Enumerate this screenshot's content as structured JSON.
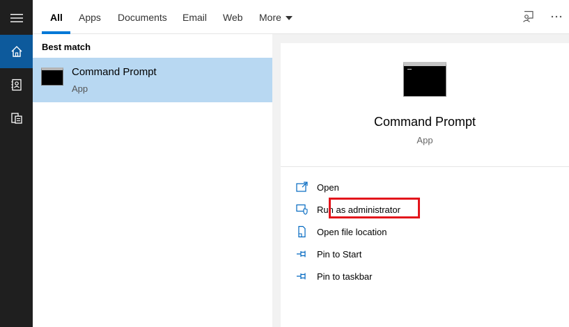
{
  "tabs": [
    {
      "label": "All",
      "active": true
    },
    {
      "label": "Apps"
    },
    {
      "label": "Documents"
    },
    {
      "label": "Email"
    },
    {
      "label": "Web"
    },
    {
      "label": "More"
    }
  ],
  "results": {
    "section_label": "Best match",
    "best_match": {
      "title": "Command Prompt",
      "subtitle": "App"
    }
  },
  "details": {
    "title": "Command Prompt",
    "subtitle": "App",
    "actions": [
      {
        "label": "Open",
        "icon": "open-icon"
      },
      {
        "label": "Run as administrator",
        "icon": "shield-icon",
        "highlighted": true
      },
      {
        "label": "Open file location",
        "icon": "file-location-icon"
      },
      {
        "label": "Pin to Start",
        "icon": "pin-icon"
      },
      {
        "label": "Pin to taskbar",
        "icon": "pin-icon"
      }
    ]
  },
  "colors": {
    "accent": "#0078d7",
    "rail_bg": "#1f1f1f",
    "rail_active": "#0d5a9c",
    "selected_result": "#b8d8f2",
    "highlight": "#e3141b"
  },
  "icons": {
    "rail": [
      "hamburger-menu-icon",
      "home-icon",
      "notebook-icon",
      "documents-icon"
    ],
    "topbar": [
      "feedback-icon",
      "more-options-icon"
    ]
  }
}
